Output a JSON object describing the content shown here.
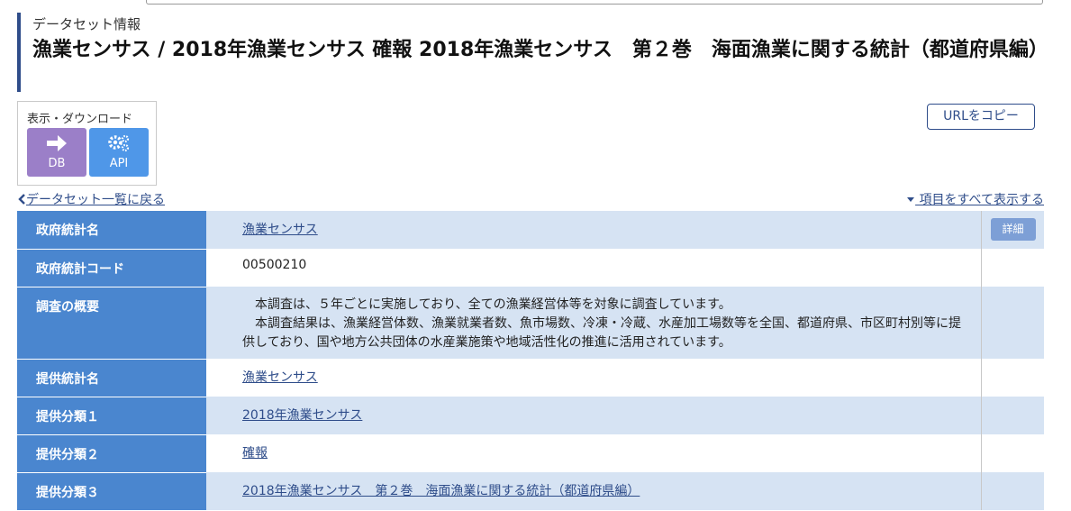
{
  "header": {
    "section_label": "データセット情報",
    "title": "漁業センサス / 2018年漁業センサス 確報 2018年漁業センサス　第２巻　海面漁業に関する統計（都道府県編）"
  },
  "download": {
    "title": "表示・ダウンロード",
    "db_label": "DB",
    "api_label": "API"
  },
  "copy_url_label": "URLをコピー",
  "nav": {
    "back_label": "データセット一覧に戻る",
    "show_all_label": "項目をすべて表示する"
  },
  "table": {
    "detail_label": "詳細",
    "rows": [
      {
        "label": "政府統計名",
        "value": "漁業センサス"
      },
      {
        "label": "政府統計コード",
        "value": "00500210"
      },
      {
        "label": "調査の概要",
        "value": "　本調査は、５年ごとに実施しており、全ての漁業経営体等を対象に調査しています。\n　本調査結果は、漁業経営体数、漁業就業者数、魚市場数、冷凍・冷蔵、水産加工場数等を全国、都道府県、市区町村別等に提供しており、国や地方公共団体の水産業施策や地域活性化の推進に活用されています。"
      },
      {
        "label": "提供統計名",
        "value": "漁業センサス"
      },
      {
        "label": "提供分類１",
        "value": "2018年漁業センサス"
      },
      {
        "label": "提供分類２",
        "value": "確報"
      },
      {
        "label": "提供分類３",
        "value": "2018年漁業センサス　第２巻　海面漁業に関する統計（都道府県編）"
      }
    ]
  },
  "colors": {
    "header_bar": "#2f4d8a",
    "table_header": "#4a86cf",
    "row_alt": "#d6e3f3",
    "db_button": "#9b7fc8",
    "api_button": "#4f97e8",
    "link": "#2f4d8a"
  },
  "icons": {
    "db": "arrow-right-icon",
    "api": "gears-icon",
    "back": "chevron-left-icon",
    "show_all": "caret-down-icon"
  }
}
